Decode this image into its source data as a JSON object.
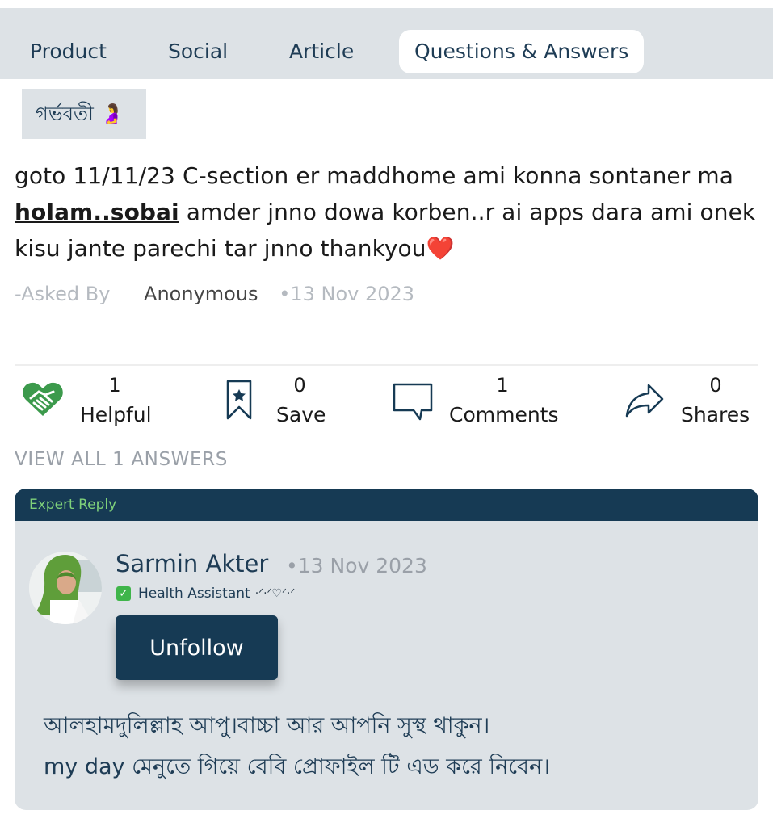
{
  "tabs": [
    "Product",
    "Social",
    "Article",
    "Questions & Answers"
  ],
  "active_tab": "Questions & Answers",
  "category": {
    "label": "গর্ভবতী 🤰"
  },
  "question": {
    "text_before": "goto 11/11/23 C-section er maddhome ami konna sontaner ma ",
    "highlight": "holam..sobai",
    "text_after": " amder jnno dowa korben..r ai apps dara ami onek kisu jante parechi tar jnno thankyou❤️",
    "asked_by_label": "-Asked By",
    "author": "Anonymous",
    "date": "•13 Nov 2023"
  },
  "actions": {
    "helpful": {
      "count": "1",
      "label": "Helpful"
    },
    "save": {
      "count": "0",
      "label": "Save"
    },
    "comments": {
      "count": "1",
      "label": "Comments"
    },
    "shares": {
      "count": "0",
      "label": "Shares"
    }
  },
  "view_all": "VIEW ALL 1 ANSWERS",
  "reply": {
    "header": "Expert Reply",
    "name": "Sarmin Akter",
    "date": "•13 Nov 2023",
    "role": "Health Assistant",
    "role_decoration": "·ᐟ·ᐟ♡ᐟ·ᐟ",
    "button": "Unfollow",
    "text_line1": "আলহামদুলিল্লাহ আপু।বাচ্চা আর আপনি সুস্থ থাকুন।",
    "text_line2": "my day মেনুতে গিয়ে বেবি প্রোফাইল টি এড করে নিবেন।"
  },
  "colors": {
    "navy": "#163a54",
    "tabbar": "#dde2e6",
    "expert_green": "#7fd17a",
    "helpful_green": "#3c9a4c"
  }
}
